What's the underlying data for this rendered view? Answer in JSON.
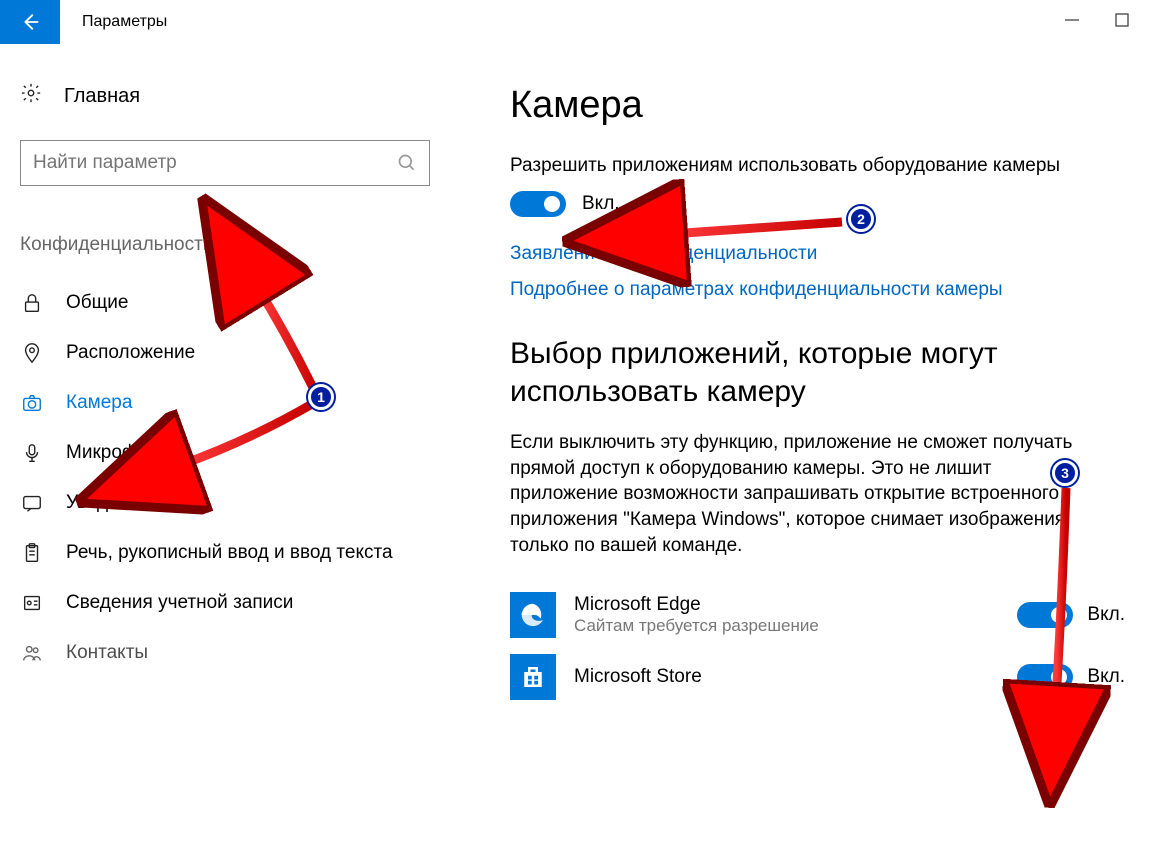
{
  "window": {
    "title": "Параметры"
  },
  "sidebar": {
    "home_label": "Главная",
    "search_placeholder": "Найти параметр",
    "category_header": "Конфиденциальность",
    "items": [
      {
        "label": "Общие",
        "icon": "lock-icon"
      },
      {
        "label": "Расположение",
        "icon": "location-icon"
      },
      {
        "label": "Камера",
        "icon": "camera-icon",
        "selected": true
      },
      {
        "label": "Микрофон",
        "icon": "microphone-icon"
      },
      {
        "label": "Уведомления",
        "icon": "notification-icon"
      },
      {
        "label": "Речь, рукописный ввод и ввод текста",
        "icon": "clipboard-icon"
      },
      {
        "label": "Сведения учетной записи",
        "icon": "account-icon"
      },
      {
        "label": "Контакты",
        "icon": "contacts-icon"
      }
    ]
  },
  "content": {
    "heading": "Камера",
    "allow_text": "Разрешить приложениям использовать оборудование камеры",
    "toggle_label": "Вкл.",
    "link_privacy": "Заявление о конфиденциальности",
    "link_more": "Подробнее о параметрах конфиденциальности камеры",
    "sub_heading": "Выбор приложений, которые могут использовать камеру",
    "desc": "Если выключить эту функцию, приложение не сможет получать прямой доступ к оборудованию камеры. Это не лишит приложение возможности запрашивать открытие встроенного приложения \"Камера Windows\", которое снимает изображения только по вашей команде.",
    "apps": [
      {
        "title": "Microsoft Edge",
        "sub": "Сайтам требуется разрешение",
        "state": "Вкл."
      },
      {
        "title": "Microsoft Store",
        "sub": "",
        "state": "Вкл."
      }
    ]
  },
  "annotations": {
    "callout1": "1",
    "callout2": "2",
    "callout3": "3"
  }
}
